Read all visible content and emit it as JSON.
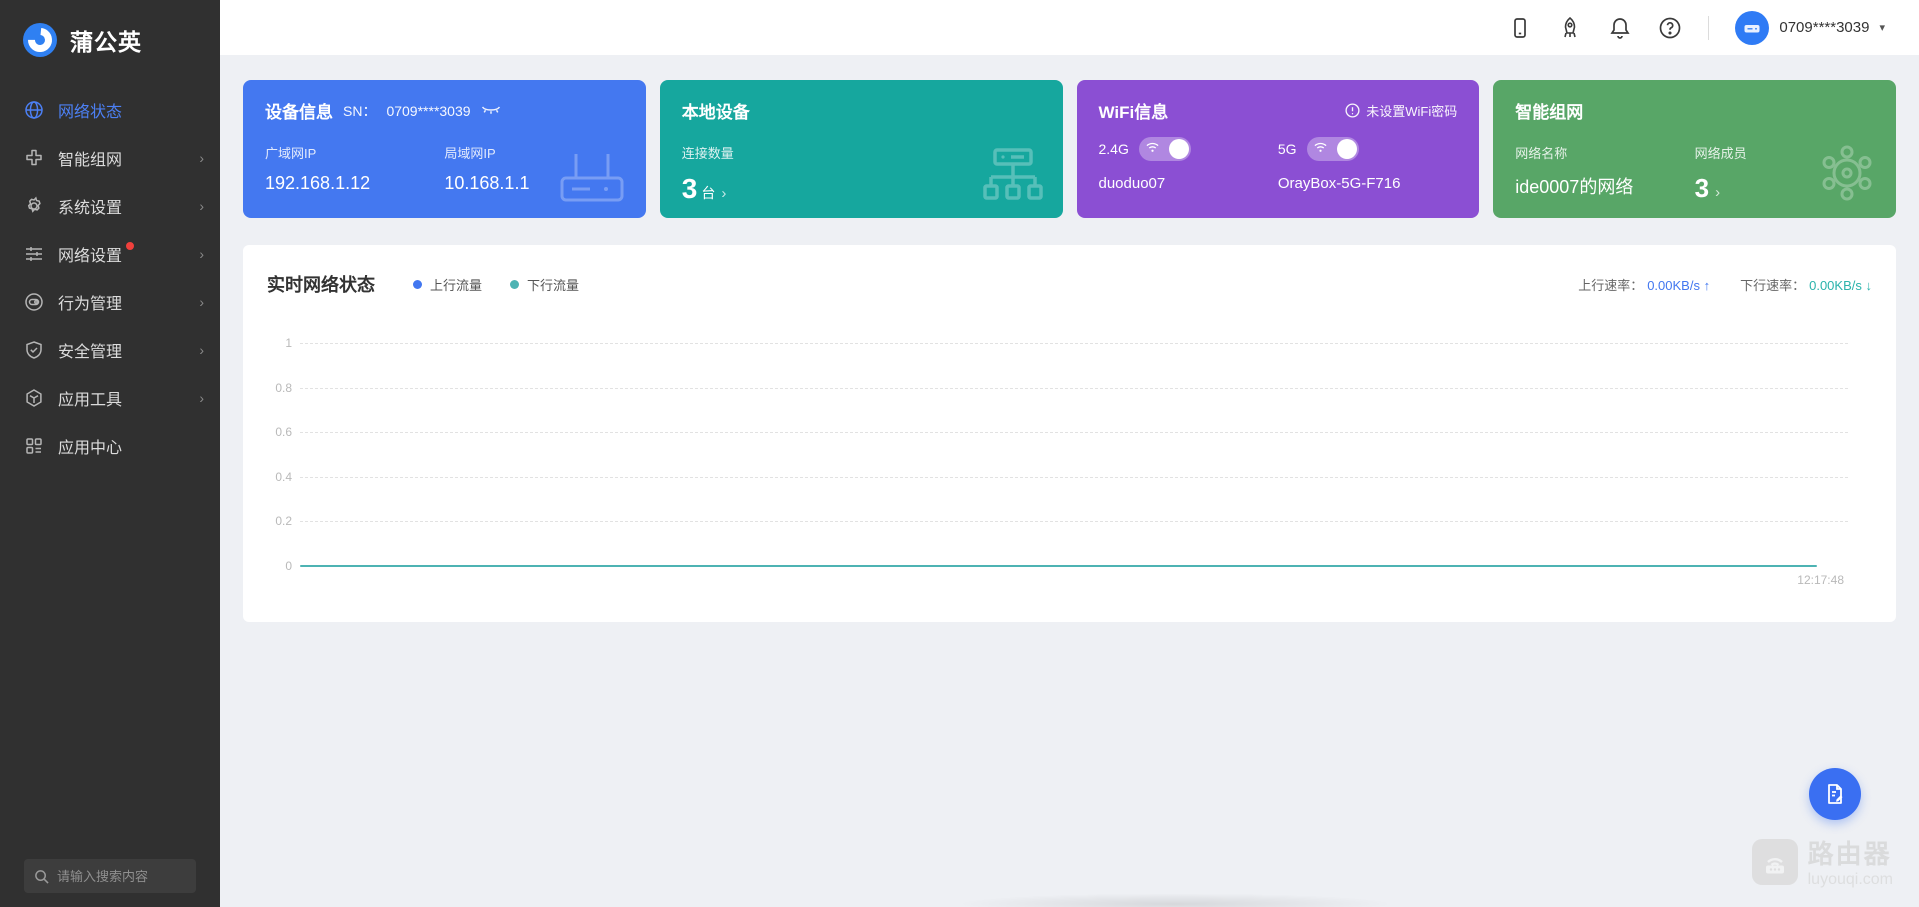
{
  "brand": {
    "name": "蒲公英"
  },
  "sidebar": {
    "items": [
      {
        "label": "网络状态",
        "icon": "globe-icon",
        "active": true,
        "chevron": false
      },
      {
        "label": "智能组网",
        "icon": "networking-icon",
        "active": false,
        "chevron": true
      },
      {
        "label": "系统设置",
        "icon": "gear-icon",
        "active": false,
        "chevron": true
      },
      {
        "label": "网络设置",
        "icon": "sliders-icon",
        "active": false,
        "chevron": true,
        "badge_dot": true
      },
      {
        "label": "行为管理",
        "icon": "behavior-icon",
        "active": false,
        "chevron": true
      },
      {
        "label": "安全管理",
        "icon": "shield-icon",
        "active": false,
        "chevron": true
      },
      {
        "label": "应用工具",
        "icon": "toolbox-icon",
        "active": false,
        "chevron": true
      },
      {
        "label": "应用中心",
        "icon": "apps-icon",
        "active": false,
        "chevron": false
      }
    ],
    "search_placeholder": "请输入搜索内容"
  },
  "topbar": {
    "icons": [
      "mobile-icon",
      "rocket-icon",
      "bell-icon",
      "help-icon"
    ],
    "account": "0709****3039"
  },
  "cards": {
    "device": {
      "color": "#4478f0",
      "title": "设备信息",
      "sn_label": "SN：",
      "sn_value": "0709****3039",
      "wan_label": "广域网IP",
      "wan_value": "192.168.1.12",
      "lan_label": "局域网IP",
      "lan_value": "10.168.1.1"
    },
    "local": {
      "color": "#16a79e",
      "title": "本地设备",
      "count_label": "连接数量",
      "count_value": "3",
      "count_unit": "台"
    },
    "wifi": {
      "color": "#8b4fd3",
      "title": "WiFi信息",
      "warning": "未设置WiFi密码",
      "band1_label": "2.4G",
      "band1_ssid": "duoduo07",
      "band2_label": "5G",
      "band2_ssid": "OrayBox-5G-F716"
    },
    "network": {
      "color": "#58a667",
      "title": "智能组网",
      "name_label": "网络名称",
      "name_value": "ide0007的网络",
      "member_label": "网络成员",
      "member_value": "3"
    }
  },
  "chart_card": {
    "title": "实时网络状态",
    "up_rate_label": "上行速率：",
    "up_rate_value": "0.00KB/s",
    "up_arrow": "↑",
    "down_rate_label": "下行速率：",
    "down_rate_value": "0.00KB/s",
    "down_arrow": "↓"
  },
  "chart_data": {
    "type": "line",
    "title": "实时网络状态",
    "series": [
      {
        "name": "上行流量",
        "color": "#4277f0",
        "values": [
          0
        ]
      },
      {
        "name": "下行流量",
        "color": "#4db3b3",
        "values": [
          0
        ]
      }
    ],
    "x_ticks": [
      "12:17:48"
    ],
    "yticks": [
      0,
      0.2,
      0.4,
      0.6,
      0.8,
      1
    ],
    "ylim": [
      0,
      1
    ],
    "grid": "dashed-horizontal",
    "legend_position": "top-left",
    "note": "both series flat at 0; visible plotted line is the download series at y=0"
  },
  "fab": {
    "icon": "edit-document-icon",
    "color": "#3a6ff2"
  },
  "watermark": {
    "title": "路由器",
    "subtitle": "luyouqi.com"
  }
}
